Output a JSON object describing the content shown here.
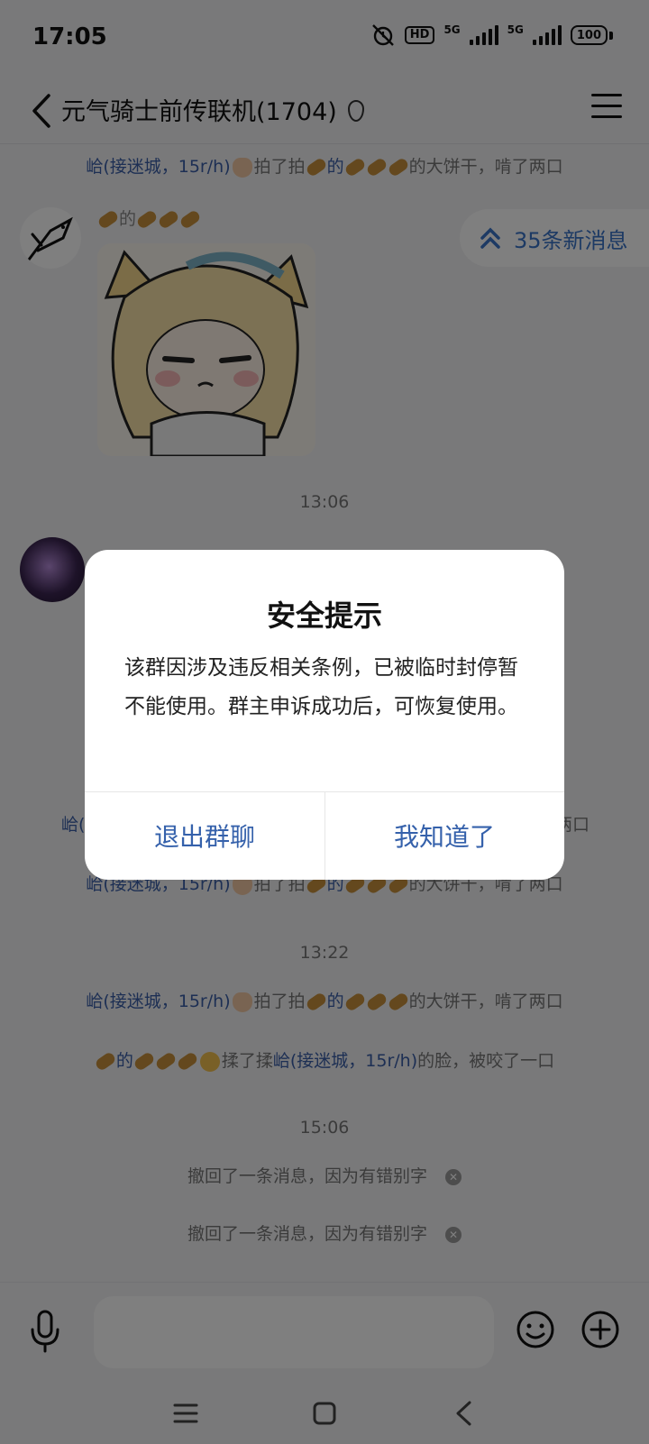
{
  "status": {
    "time": "17:05",
    "hd": "HD",
    "net1": "5G",
    "net2": "5G",
    "battery": "100"
  },
  "header": {
    "title": "元气骑士前传联机(1704)"
  },
  "new_messages": "35条新消息",
  "messages": {
    "m1": {
      "name": "峆(接迷城，15r/h)",
      "pre": "拍了拍",
      "target": "的",
      "post": "的大饼干，啃了两口"
    },
    "sender1": "的",
    "time1": "13:06",
    "m2": {
      "name": "峆(",
      "tail": "两口"
    },
    "m3": {
      "name": "峆(接迷城，15r/h)",
      "pre": "拍了拍",
      "target": "的",
      "post": "的大饼干，啃了两口"
    },
    "time2": "13:22",
    "m4": {
      "name": "峆(接迷城，15r/h)",
      "pre": "拍了拍",
      "target": "的",
      "post": "的大饼干，啃了两口"
    },
    "m5": {
      "a": "的",
      "pre": "揉了揉",
      "name": "峆(接迷城，15r/h)",
      "post": "的脸，被咬了一口"
    },
    "time3": "15:06",
    "recall1": "撤回了一条消息，因为有错别字",
    "recall2": "撤回了一条消息，因为有错别字"
  },
  "dialog": {
    "title": "安全提示",
    "body": "该群因涉及违反相关条例，已被临时封停暂不能使用。群主申诉成功后，可恢复使用。",
    "exit_label": "退出群聊",
    "ok_label": "我知道了"
  }
}
